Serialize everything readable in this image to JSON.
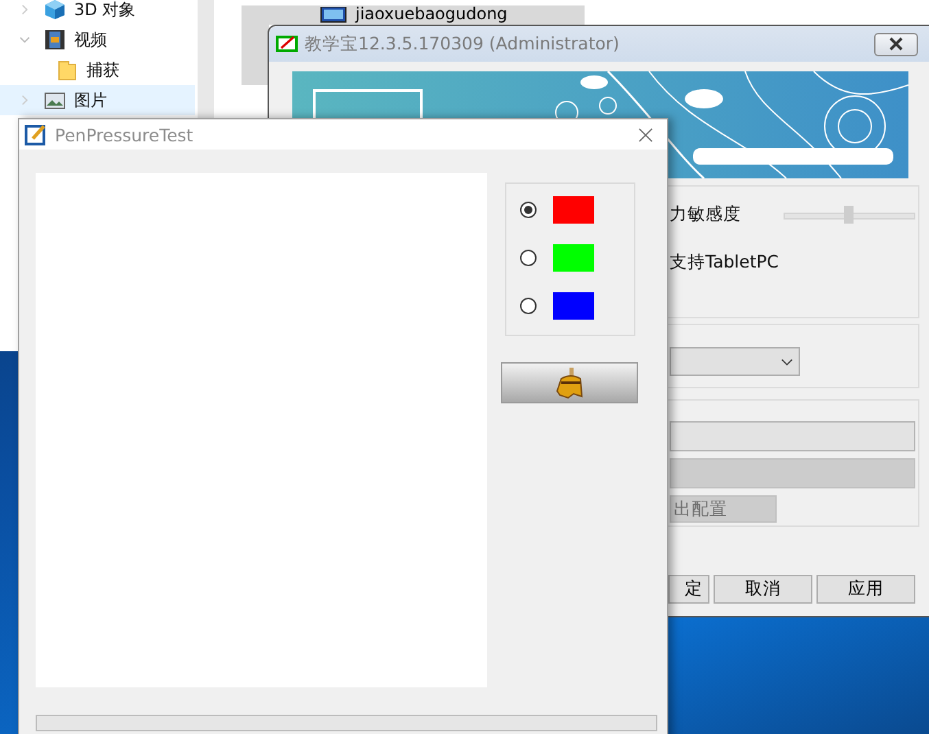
{
  "explorer": {
    "nav_items": [
      {
        "label": "3D 对象",
        "kind": "objects",
        "expanded": false,
        "selected": false
      },
      {
        "label": "视频",
        "kind": "videos",
        "expanded": true,
        "selected": false,
        "children": [
          {
            "label": "捕获",
            "kind": "folder",
            "selected": false
          }
        ]
      },
      {
        "label": "图片",
        "kind": "pictures",
        "expanded": false,
        "selected": true
      }
    ],
    "file_item": {
      "label": "jiaoxuebaogudong",
      "selected": true
    }
  },
  "app_window": {
    "title": "教学宝12.3.5.170309 (Administrator)",
    "sensitivity_label": "力敏感度",
    "sensitivity": {
      "level": 0.5
    },
    "tablet_label": "支持TabletPC",
    "export_button": {
      "label": "出配置",
      "disabled": true
    },
    "buttons": [
      "定",
      "取消",
      "应用"
    ]
  },
  "pen_window": {
    "title": "PenPressureTest",
    "colors": [
      {
        "color": "#ff0000",
        "selected": true
      },
      {
        "color": "#00ff00",
        "selected": false
      },
      {
        "color": "#0000ff",
        "selected": false
      }
    ],
    "progress": {
      "level": 0
    }
  }
}
